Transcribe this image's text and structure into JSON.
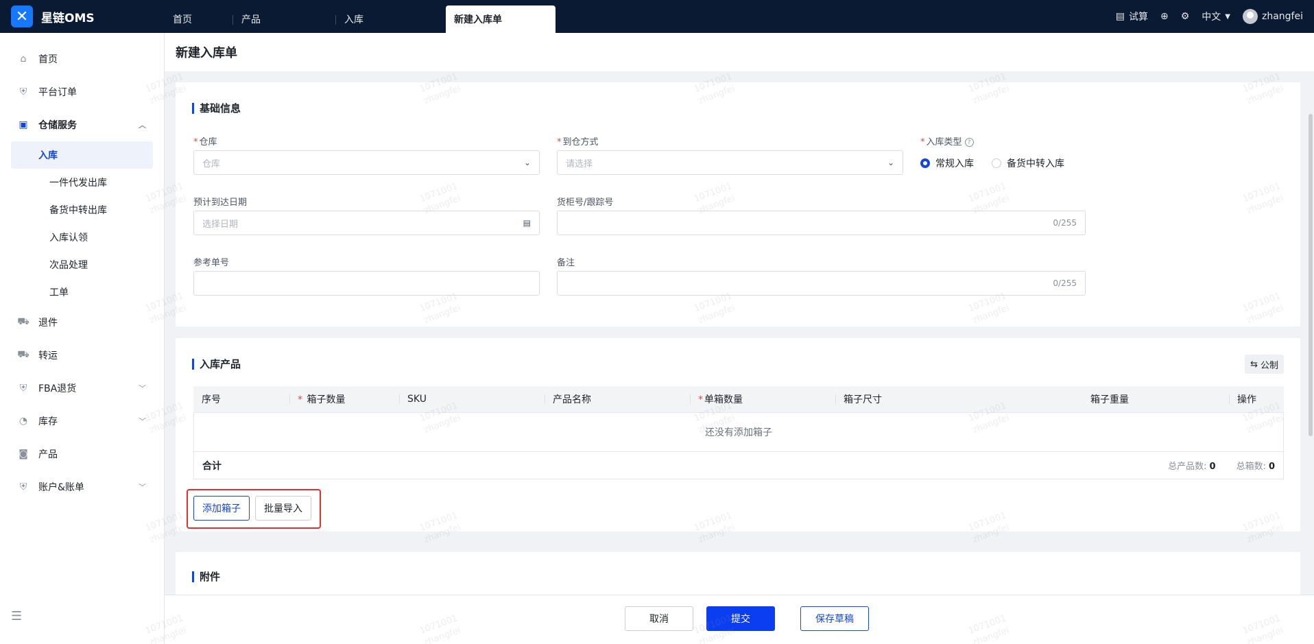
{
  "app": {
    "name": "星链OMS"
  },
  "tabs": [
    {
      "label": "首页"
    },
    {
      "label": "产品"
    },
    {
      "label": "入库"
    },
    {
      "label": "新建入库单"
    }
  ],
  "topright": {
    "calc": "试算",
    "lang": "中文",
    "user": "zhangfei"
  },
  "sidebar": {
    "items": [
      {
        "label": "首页"
      },
      {
        "label": "平台订单"
      },
      {
        "label": "仓储服务"
      },
      {
        "label": "退件"
      },
      {
        "label": "转运"
      },
      {
        "label": "FBA退货"
      },
      {
        "label": "库存"
      },
      {
        "label": "产品"
      },
      {
        "label": "账户&账单"
      }
    ],
    "sub_items": [
      {
        "label": "入库"
      },
      {
        "label": "一件代发出库"
      },
      {
        "label": "备货中转出库"
      },
      {
        "label": "入库认领"
      },
      {
        "label": "次品处理"
      },
      {
        "label": "工单"
      }
    ]
  },
  "page": {
    "title": "新建入库单"
  },
  "basic": {
    "title": "基础信息",
    "warehouse_label": "仓库",
    "warehouse_placeholder": "仓库",
    "arrival_label": "到仓方式",
    "arrival_placeholder": "请选择",
    "type_label": "入库类型",
    "type_options": [
      "常规入库",
      "备货中转入库"
    ],
    "eta_label": "预计到达日期",
    "eta_placeholder": "选择日期",
    "container_label": "货柜号/跟踪号",
    "container_count": "0/255",
    "ref_label": "参考单号",
    "remark_label": "备注",
    "remark_count": "0/255"
  },
  "products": {
    "title": "入库产品",
    "unit_button": "公制",
    "columns": [
      "序号",
      "箱子数量",
      "SKU",
      "产品名称",
      "单箱数量",
      "箱子尺寸",
      "箱子重量",
      "操作"
    ],
    "empty_text": "还没有添加箱子",
    "total_label": "合计",
    "total_products_label": "总产品数:",
    "total_products_value": "0",
    "total_boxes_label": "总箱数:",
    "total_boxes_value": "0",
    "add_box": "添加箱子",
    "bulk_import": "批量导入"
  },
  "attachments": {
    "title": "附件"
  },
  "footer": {
    "cancel": "取消",
    "submit": "提交",
    "save_draft": "保存草稿"
  },
  "watermark": {
    "line1": "1071001",
    "line2": "zhangfei"
  },
  "colors": {
    "topbar": "#0b1a33",
    "primary": "#1646d9",
    "highlight": "#e62e2e"
  }
}
